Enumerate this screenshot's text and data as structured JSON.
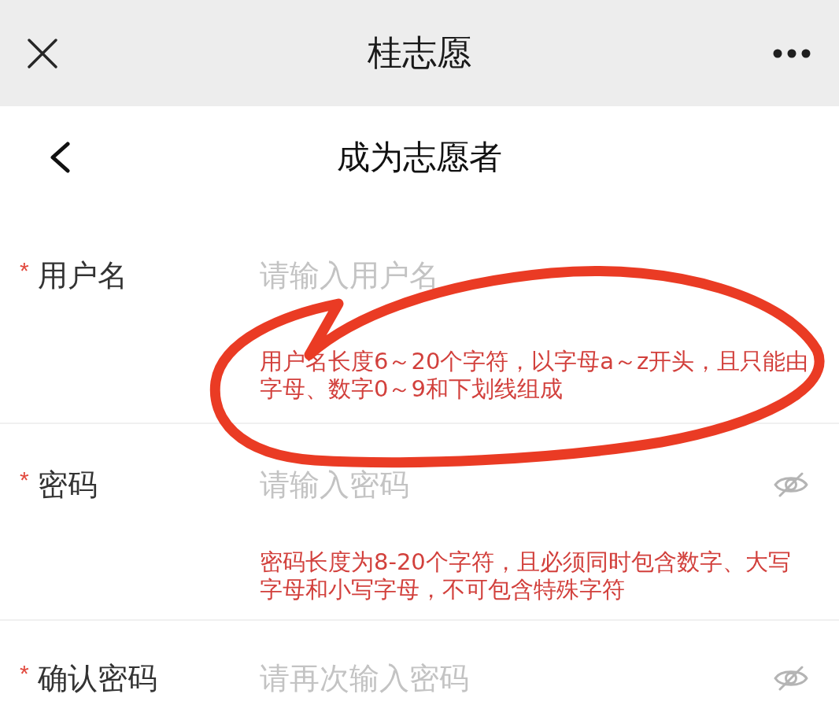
{
  "top_bar": {
    "title": "桂志愿"
  },
  "nav_bar": {
    "title": "成为志愿者"
  },
  "fields": [
    {
      "kind": "text",
      "required_mark": "*",
      "label": "用户名",
      "placeholder": "请输入用户名",
      "hint": "用户名长度6～20个字符，以字母a～z开头，且只能由字母、数字0～9和下划线组成"
    },
    {
      "kind": "password",
      "required_mark": "*",
      "label": "密码",
      "placeholder": "请输入密码",
      "revealed": false,
      "hint": "密码长度为8-20个字符，且必须同时包含数字、大写字母和小写字母，不可包含特殊字符"
    },
    {
      "kind": "password",
      "required_mark": "*",
      "label": "确认密码",
      "placeholder": "请再次输入密码",
      "revealed": false
    }
  ]
}
